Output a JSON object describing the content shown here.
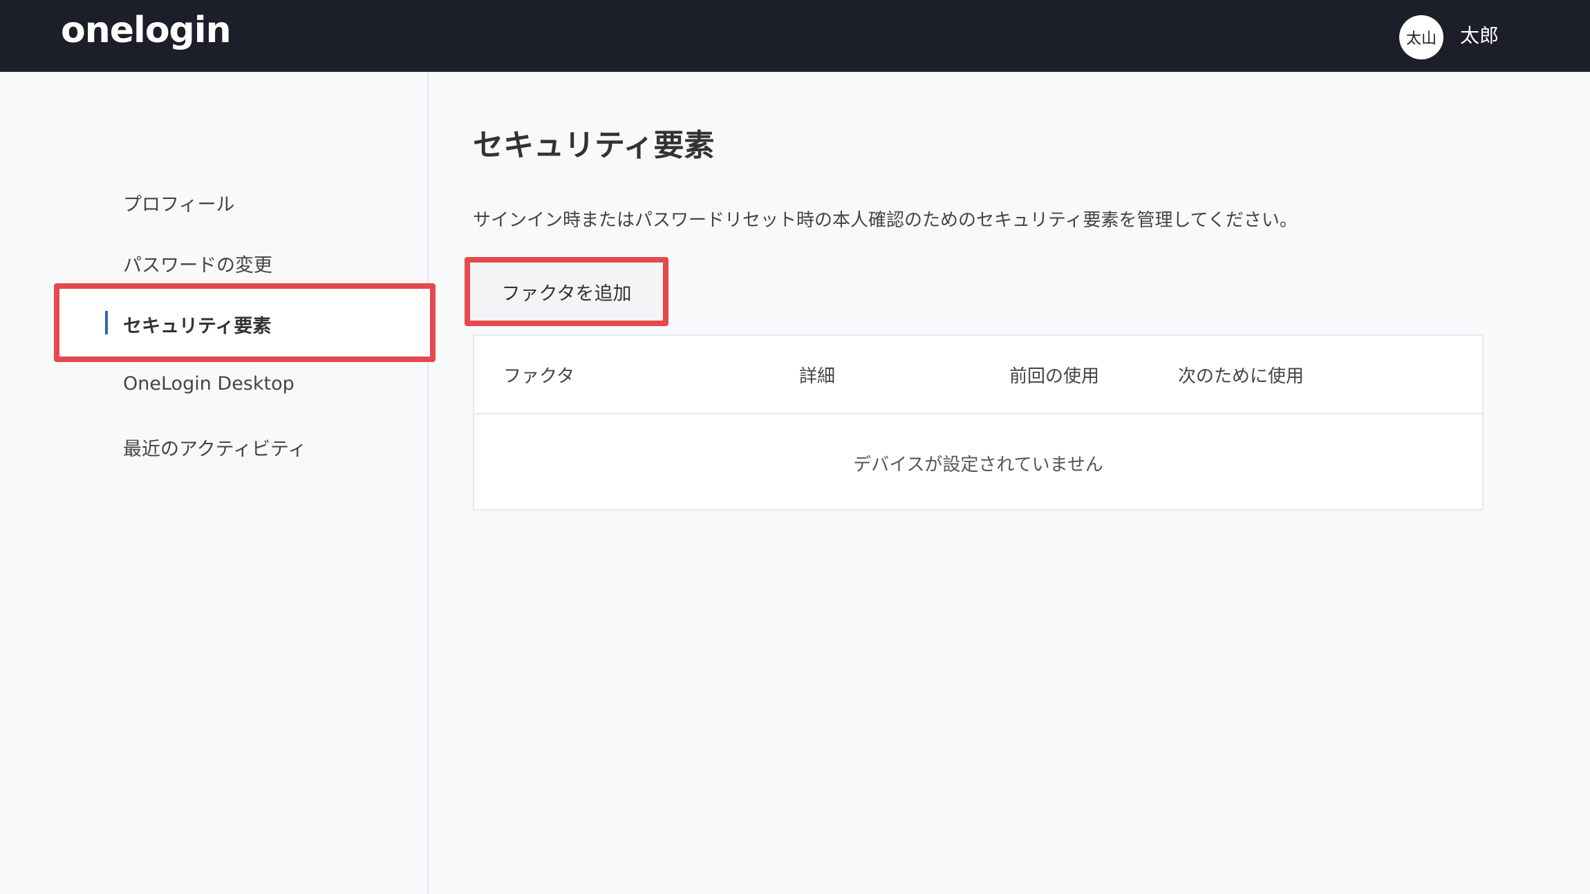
{
  "header": {
    "logo": "onelogin",
    "avatar_initials": "太山",
    "username": "太郎"
  },
  "sidebar": {
    "items": [
      {
        "label": "プロフィール"
      },
      {
        "label": "パスワードの変更"
      },
      {
        "label": "セキュリティ要素",
        "active": true
      },
      {
        "label": "OneLogin Desktop"
      },
      {
        "label": "最近のアクティビティ"
      }
    ]
  },
  "main": {
    "title": "セキュリティ要素",
    "description": "サインイン時またはパスワードリセット時の本人確認のためのセキュリティ要素を管理してください。",
    "add_button": "ファクタを追加",
    "table": {
      "columns": [
        "ファクタ",
        "詳細",
        "前回の使用",
        "次のために使用"
      ],
      "empty_message": "デバイスが設定されていません"
    }
  },
  "colors": {
    "topbar": "#1c1f2a",
    "highlight": "#e5484d",
    "active_indicator": "#2d6aa3",
    "background": "#f8f9fa"
  }
}
